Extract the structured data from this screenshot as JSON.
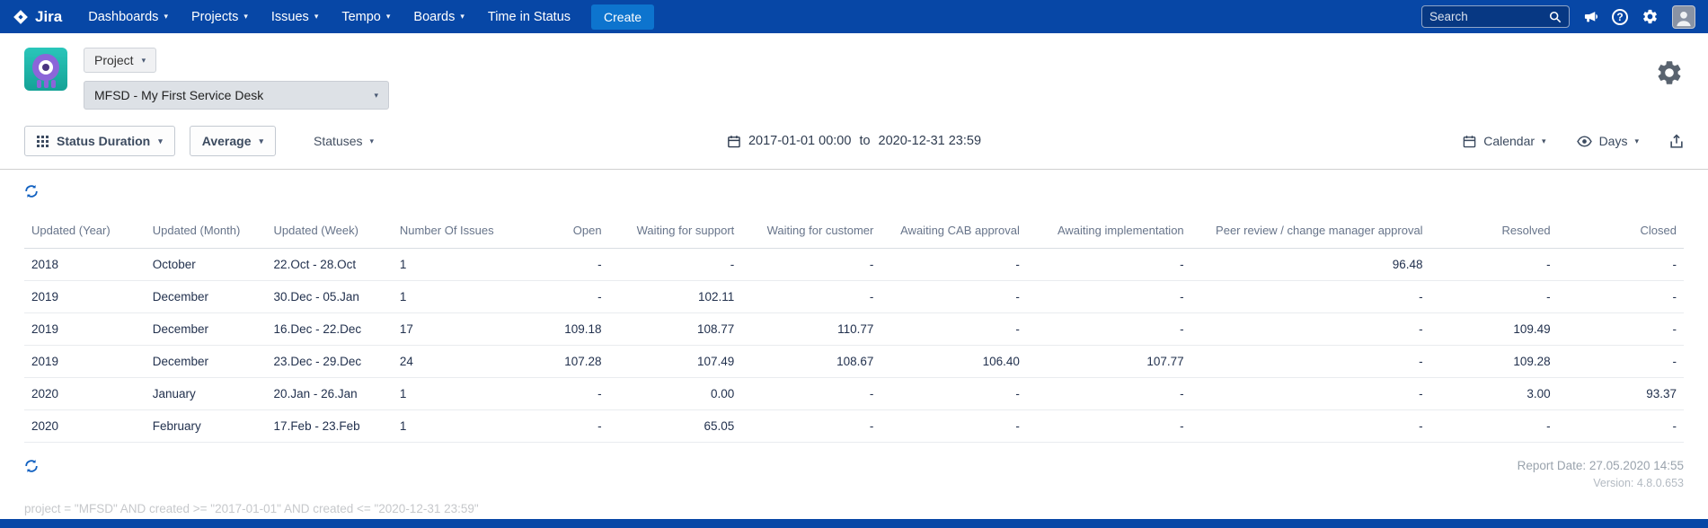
{
  "nav": {
    "brand": "Jira",
    "items": [
      {
        "label": "Dashboards",
        "chevron": true
      },
      {
        "label": "Projects",
        "chevron": true
      },
      {
        "label": "Issues",
        "chevron": true
      },
      {
        "label": "Tempo",
        "chevron": true
      },
      {
        "label": "Boards",
        "chevron": true
      },
      {
        "label": "Time in Status",
        "chevron": false
      }
    ],
    "create_label": "Create",
    "search": {
      "placeholder": "Search"
    }
  },
  "header": {
    "project_label": "Project",
    "project_value": "MFSD - My First Service Desk"
  },
  "toolbar": {
    "report_type": "Status Duration",
    "metric": "Average",
    "statuses_label": "Statuses",
    "date_from": "2017-01-01 00:00",
    "date_separator": "to",
    "date_to": "2020-12-31 23:59",
    "calendar_label": "Calendar",
    "unit_label": "Days"
  },
  "table": {
    "columns": [
      "Updated (Year)",
      "Updated (Month)",
      "Updated (Week)",
      "Number Of Issues",
      "Open",
      "Waiting for support",
      "Waiting for customer",
      "Awaiting CAB approval",
      "Awaiting implementation",
      "Peer review / change manager approval",
      "Resolved",
      "Closed"
    ],
    "rows": [
      [
        "2018",
        "October",
        "22.Oct - 28.Oct",
        "1",
        "-",
        "-",
        "-",
        "-",
        "-",
        "96.48",
        "-",
        "-"
      ],
      [
        "2019",
        "December",
        "30.Dec - 05.Jan",
        "1",
        "-",
        "102.11",
        "-",
        "-",
        "-",
        "-",
        "-",
        "-"
      ],
      [
        "2019",
        "December",
        "16.Dec - 22.Dec",
        "17",
        "109.18",
        "108.77",
        "110.77",
        "-",
        "-",
        "-",
        "109.49",
        "-"
      ],
      [
        "2019",
        "December",
        "23.Dec - 29.Dec",
        "24",
        "107.28",
        "107.49",
        "108.67",
        "106.40",
        "107.77",
        "-",
        "109.28",
        "-"
      ],
      [
        "2020",
        "January",
        "20.Jan - 26.Jan",
        "1",
        "-",
        "0.00",
        "-",
        "-",
        "-",
        "-",
        "3.00",
        "93.37"
      ],
      [
        "2020",
        "February",
        "17.Feb - 23.Feb",
        "1",
        "-",
        "65.05",
        "-",
        "-",
        "-",
        "-",
        "-",
        "-"
      ]
    ]
  },
  "footer": {
    "report_date": "Report Date: 27.05.2020 14:55",
    "version": "Version: 4.8.0.653",
    "query": "project = \"MFSD\" AND created >= \"2017-01-01\" AND created <= \"2020-12-31 23:59\""
  }
}
